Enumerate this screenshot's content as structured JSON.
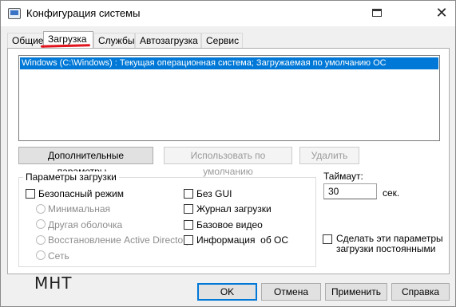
{
  "window": {
    "title": "Конфигурация системы"
  },
  "tabs": [
    {
      "label": "Общие"
    },
    {
      "label": "Загрузка"
    },
    {
      "label": "Службы"
    },
    {
      "label": "Автозагрузка"
    },
    {
      "label": "Сервис"
    }
  ],
  "os_list": {
    "items": [
      "Windows (C:\\Windows) : Текущая операционная система; Загружаемая по умолчанию ОС"
    ]
  },
  "os_buttons": {
    "advanced": "Дополнительные параметры...",
    "set_default": "Использовать по умолчанию",
    "delete": "Удалить"
  },
  "boot_options": {
    "title": "Параметры загрузки",
    "safe_mode": "Безопасный режим",
    "safe_mode_options": [
      "Минимальная",
      "Другая оболочка",
      "Восстановление Active Directory",
      "Сеть"
    ],
    "no_gui": "Без GUI",
    "boot_log": "Журнал загрузки",
    "base_video": "Базовое видео",
    "os_info": "Информация  об ОС"
  },
  "timeout": {
    "label": "Таймаут:",
    "value": "30",
    "unit": "сек."
  },
  "make_permanent": "Сделать эти параметры загрузки постоянными",
  "dialog_buttons": {
    "ok": "OK",
    "cancel": "Отмена",
    "apply": "Применить",
    "help": "Справка"
  },
  "handwritten_note": "МНТ",
  "colors": {
    "selection": "#0078d7",
    "annotation_red": "#e1141d"
  }
}
